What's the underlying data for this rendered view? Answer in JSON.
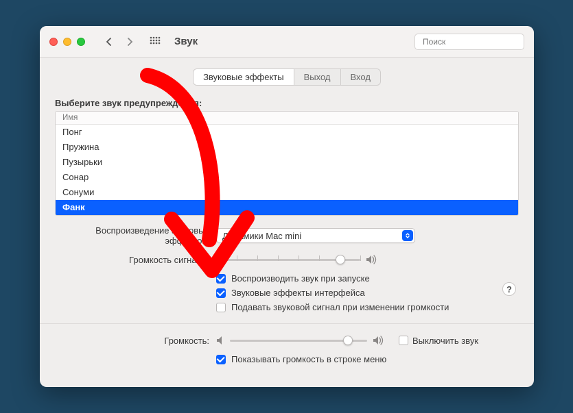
{
  "window": {
    "title": "Звук",
    "search_placeholder": "Поиск"
  },
  "tabs": {
    "items": [
      "Звуковые эффекты",
      "Выход",
      "Вход"
    ],
    "active_index": 0
  },
  "alert_sound": {
    "label": "Выберите звук предупреждения:",
    "column_header": "Имя",
    "rows": [
      "Понг",
      "Пружина",
      "Пузырьки",
      "Сонар",
      "Сонуми",
      "Фанк"
    ],
    "selected_index": 5
  },
  "playback_device": {
    "label": "Воспроизведение звуковых эффектов:",
    "value": "Динамики Mac mini"
  },
  "alert_volume": {
    "label": "Громкость сигнала:",
    "value_percent": 86
  },
  "checkboxes": {
    "play_on_startup": {
      "label": "Воспроизводить звук при запуске",
      "checked": true
    },
    "ui_effects": {
      "label": "Звуковые эффекты интерфейса",
      "checked": true
    },
    "feedback_on_volume_change": {
      "label": "Подавать звуковой сигнал при изменении громкости",
      "checked": false
    }
  },
  "output_volume": {
    "label": "Громкость:",
    "value_percent": 86,
    "mute_label": "Выключить звук",
    "mute_checked": false
  },
  "menu_bar": {
    "label": "Показывать громкость в строке меню",
    "checked": true
  },
  "help": "?"
}
